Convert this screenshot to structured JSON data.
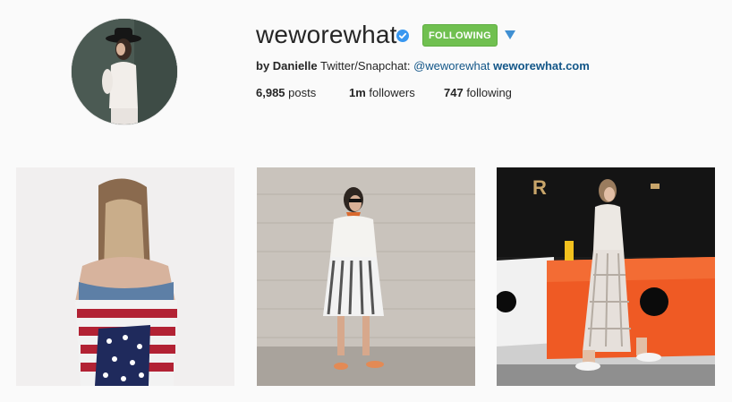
{
  "profile": {
    "username": "weworewhat",
    "verified_icon": "verified-badge-icon",
    "follow_button_label": "FOLLOWING",
    "bio": {
      "name": "by Danielle",
      "text": " Twitter/Snapchat: ",
      "handle": "@weworewhat",
      "website": "weworewhat.com"
    },
    "stats": {
      "posts_count": "6,985",
      "posts_label": " posts",
      "followers_count": "1m",
      "followers_label": " followers",
      "following_count": "747",
      "following_label": " following"
    }
  },
  "colors": {
    "follow_green": "#70c050",
    "link_blue": "#125688",
    "verified_blue": "#3897f0"
  },
  "photos": [
    {
      "icon": "woman-back-flag-photo"
    },
    {
      "icon": "woman-striped-skirt-photo"
    },
    {
      "icon": "woman-plaid-dress-photo"
    }
  ]
}
